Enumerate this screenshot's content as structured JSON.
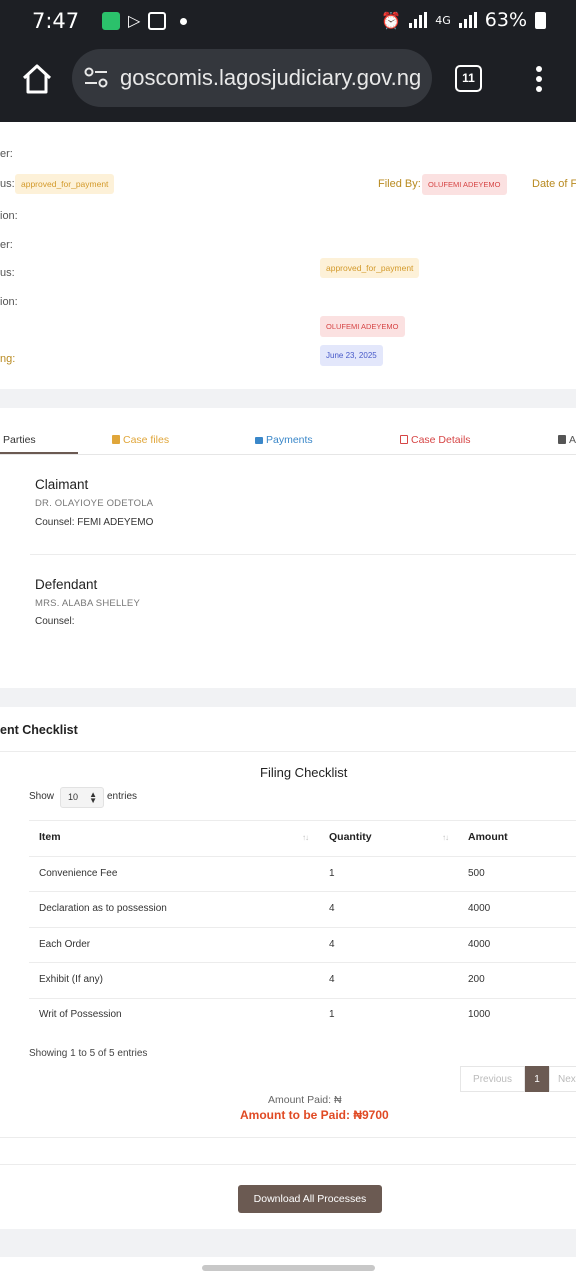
{
  "status_bar": {
    "time": "7:47",
    "network": "4G",
    "battery": "63%"
  },
  "browser": {
    "url": "goscomis.lagosjudiciary.gov.ng",
    "tab_count": "11"
  },
  "case_info": {
    "label_number_1": "er:",
    "label_status_1": "us:",
    "status_badge_1": "approved_for_payment",
    "filed_by_label": "Filed By:",
    "filed_by_value": "OLUFEMI ADEYEMO",
    "date_label": "Date of F",
    "label_location_1": "ion:",
    "label_number_2": "er:",
    "label_status_2": "us:",
    "status_badge_2": "approved_for_payment",
    "label_location_2": "ion:",
    "filer_badge": "OLUFEMI ADEYEMO",
    "label_filing": "ng:",
    "date_badge": "June 23, 2025"
  },
  "tabs": [
    {
      "label": "Parties",
      "color": "#6b5a52"
    },
    {
      "label": "Case files",
      "color": "#e0a63a"
    },
    {
      "label": "Payments",
      "color": "#3a87c9"
    },
    {
      "label": "Case Details",
      "color": "#d64545"
    },
    {
      "label": "A",
      "color": "#555555"
    }
  ],
  "parties": {
    "claimant": {
      "title": "Claimant",
      "name": "DR. OLAYIOYE ODETOLA",
      "counsel": "Counsel: FEMI ADEYEMO"
    },
    "defendant": {
      "title": "Defendant",
      "name": "MRS. ALABA SHELLEY",
      "counsel": "Counsel:"
    }
  },
  "checklist": {
    "section_title": "ent Checklist",
    "table_title": "Filing Checklist",
    "show_label": "Show",
    "show_value": "10",
    "entries_label": "entries",
    "columns": [
      "Item",
      "Quantity",
      "Amount"
    ],
    "rows": [
      [
        "Convenience Fee",
        "1",
        "500"
      ],
      [
        "Declaration as to possession",
        "4",
        "4000"
      ],
      [
        "Each Order",
        "4",
        "4000"
      ],
      [
        "Exhibit (If any)",
        "4",
        "200"
      ],
      [
        "Writ of Possession",
        "1",
        "1000"
      ]
    ],
    "showing": "Showing 1 to 5 of 5 entries",
    "pagination": {
      "previous": "Previous",
      "page": "1",
      "next": "Nex"
    },
    "amount_paid": "Amount Paid: ₦",
    "amount_to_be_paid": "Amount to be Paid: ₦9700",
    "download_button": "Download All Processes"
  }
}
